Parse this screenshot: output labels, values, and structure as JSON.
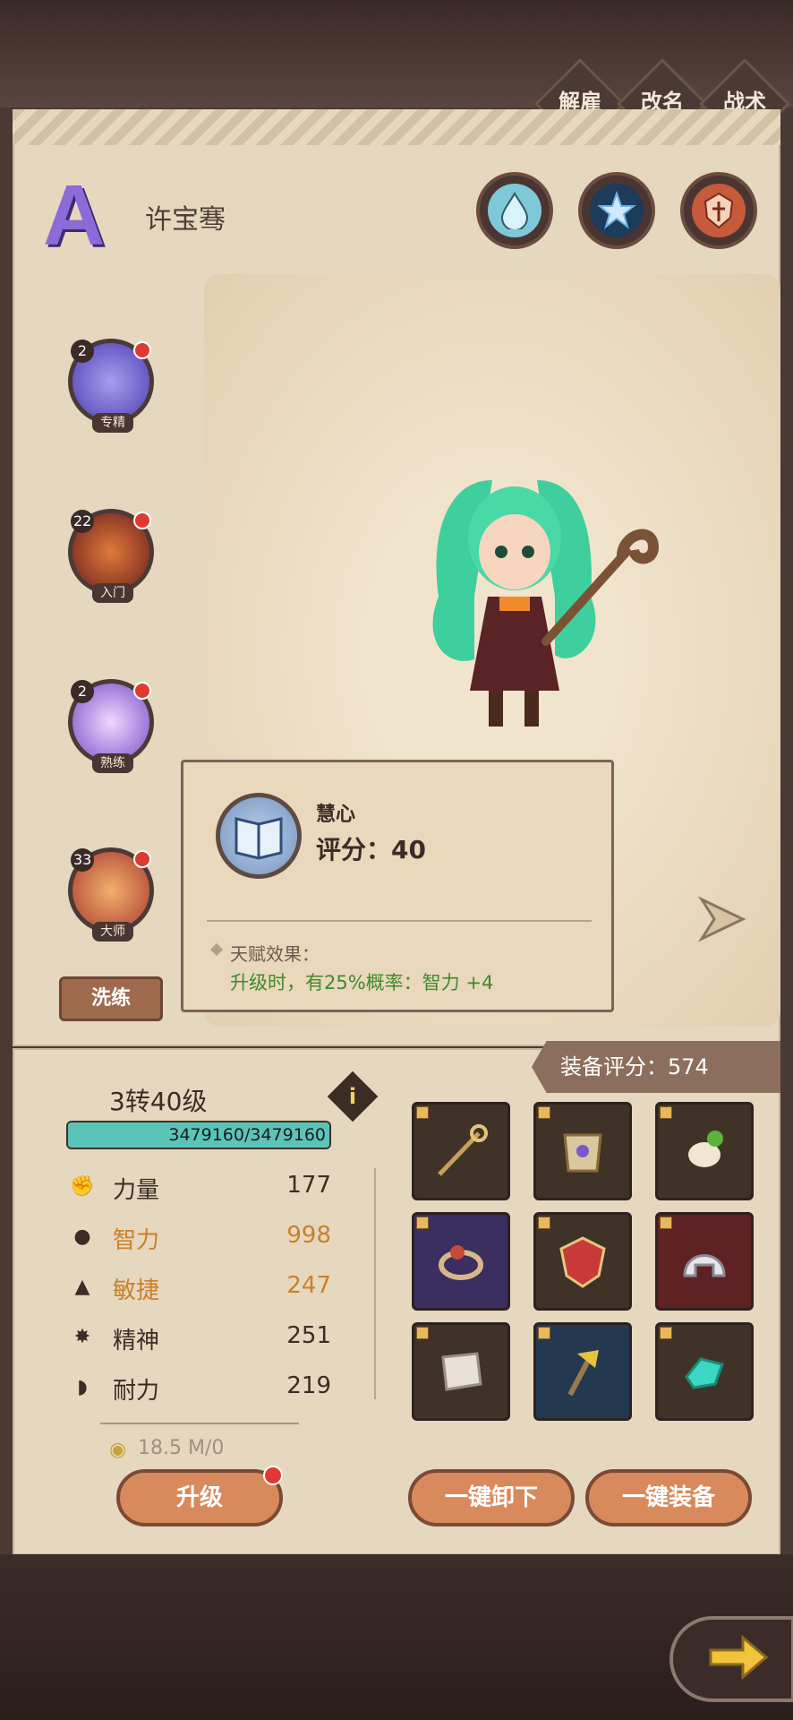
{
  "top_actions": [
    {
      "label": "解雇"
    },
    {
      "label": "改名"
    },
    {
      "label": "战术"
    }
  ],
  "hero": {
    "grade": "A",
    "name": "许宝骞"
  },
  "elements": [
    {
      "icon": "water-drop-icon"
    },
    {
      "icon": "star-emblem-icon"
    },
    {
      "icon": "fire-helm-icon"
    }
  ],
  "skills": [
    {
      "level": "2",
      "tag": "专精",
      "color": "#6b5bd6"
    },
    {
      "level": "22",
      "tag": "入门",
      "color": "#8f2b2b"
    },
    {
      "level": "2",
      "tag": "熟练",
      "color": "#a777e0"
    },
    {
      "level": "33",
      "tag": "大师",
      "color": "#a83b32"
    }
  ],
  "refine_label": "洗练",
  "tooltip": {
    "name": "慧心",
    "score_label": "评分：40",
    "effect_title": "天赋效果：",
    "effect_text": "升级时，有25%概率：智力 +4"
  },
  "equipment_rating": "装备评分：574",
  "level": "3转40级",
  "hp": {
    "text": "3479160/3479160",
    "fill_fraction": 1.0
  },
  "stats": [
    {
      "icon": "fist-icon",
      "name": "力量",
      "value": "177",
      "highlight": false
    },
    {
      "icon": "brain-icon",
      "name": "智力",
      "value": "998",
      "highlight": true
    },
    {
      "icon": "boot-icon",
      "name": "敏捷",
      "value": "247",
      "highlight": true
    },
    {
      "icon": "spirit-icon",
      "name": "精神",
      "value": "251",
      "highlight": false
    },
    {
      "icon": "arm-icon",
      "name": "耐力",
      "value": "219",
      "highlight": false
    }
  ],
  "gold": "18.5 M/0",
  "equipment": [
    {
      "item": "staff-icon",
      "bg": "#3f3327"
    },
    {
      "item": "armor-icon",
      "bg": "#3f3327"
    },
    {
      "item": "gloves-icon",
      "bg": "#3f3327"
    },
    {
      "item": "ring-icon",
      "bg": "#3a2f5e"
    },
    {
      "item": "shield-icon",
      "bg": "#3f3327"
    },
    {
      "item": "helmet-icon",
      "bg": "#5e2222"
    },
    {
      "item": "scroll-icon",
      "bg": "#3f3327"
    },
    {
      "item": "axe-icon",
      "bg": "#24384f"
    },
    {
      "item": "gem-icon",
      "bg": "#3f3327"
    }
  ],
  "buttons": {
    "upgrade": "升级",
    "unequip_all": "一键卸下",
    "equip_all": "一键装备"
  }
}
